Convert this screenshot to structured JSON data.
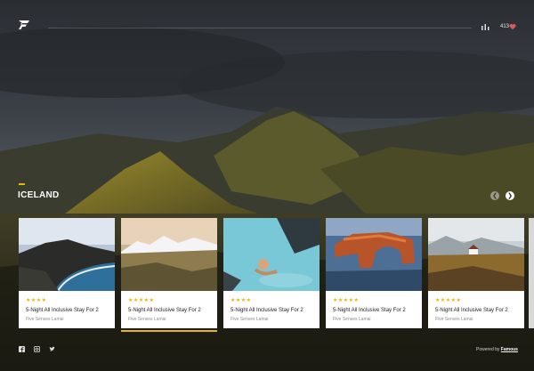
{
  "header": {
    "logo_icon": "brand-logo-icon",
    "stats_icon": "bar-chart-icon",
    "likes_count": "413",
    "heart_icon": "heart-icon",
    "heart_color": "#e25555"
  },
  "section": {
    "title": "ICELAND",
    "accent_color": "#e6b800",
    "prev_icon": "chevron-left-icon",
    "next_icon": "chevron-right-icon"
  },
  "cards": [
    {
      "rating": 4,
      "stars": "★★★★",
      "title": "5-Night All Inclusive Stay For 2",
      "subtitle": "Five Senses Lamai",
      "active": false
    },
    {
      "rating": 5,
      "stars": "★★★★★",
      "title": "5-Night All Inclusive Stay For 2",
      "subtitle": "Five Senses Lamai",
      "active": true
    },
    {
      "rating": 4,
      "stars": "★★★★",
      "title": "5-Night All Inclusive Stay For 2",
      "subtitle": "Five Senses Lamai",
      "active": false
    },
    {
      "rating": 5,
      "stars": "★★★★★",
      "title": "5-Night All Inclusive Stay For 2",
      "subtitle": "Five Senses Lamai",
      "active": false
    },
    {
      "rating": 5,
      "stars": "★★★★★",
      "title": "5-Night All Inclusive Stay For 2",
      "subtitle": "Five Senses Lamai",
      "active": false
    }
  ],
  "star_color": "#f0b400",
  "footer": {
    "social_icons": [
      "facebook-icon",
      "instagram-icon",
      "twitter-icon"
    ],
    "powered_prefix": "Powered by",
    "powered_brand": "Famous"
  }
}
